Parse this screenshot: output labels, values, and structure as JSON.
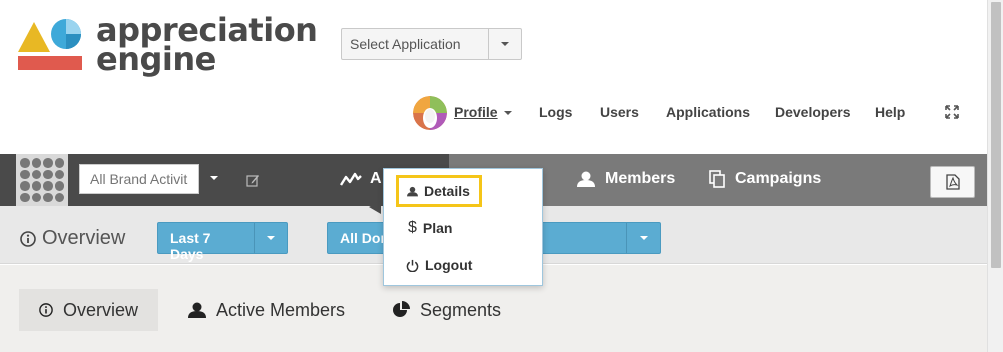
{
  "brand": {
    "name_line1": "appreciation",
    "name_line2": "engine"
  },
  "header": {
    "select_application": "Select Application",
    "nav": {
      "profile": "Profile",
      "logs": "Logs",
      "users": "Users",
      "applications": "Applications",
      "developers": "Developers",
      "help": "Help"
    }
  },
  "toolbar": {
    "brand_activity_placeholder": "All Brand Activit",
    "tabs": {
      "activity": "A",
      "members": "Members",
      "campaigns": "Campaigns"
    }
  },
  "profile_menu": {
    "details": "Details",
    "plan": "Plan",
    "logout": "Logout"
  },
  "filters": {
    "overview_title": "Overview",
    "date_range": "Last 7 Days",
    "domains": "All Dor"
  },
  "subtabs": {
    "overview": "Overview",
    "active_members": "Active Members",
    "segments": "Segments"
  },
  "colors": {
    "accent_blue": "#5bacd2",
    "dark_bar": "#4a4a4a",
    "highlight": "#f5c518",
    "logo_yellow": "#e8b824",
    "logo_blue": "#3ea9d9",
    "logo_red": "#e05a4e"
  }
}
